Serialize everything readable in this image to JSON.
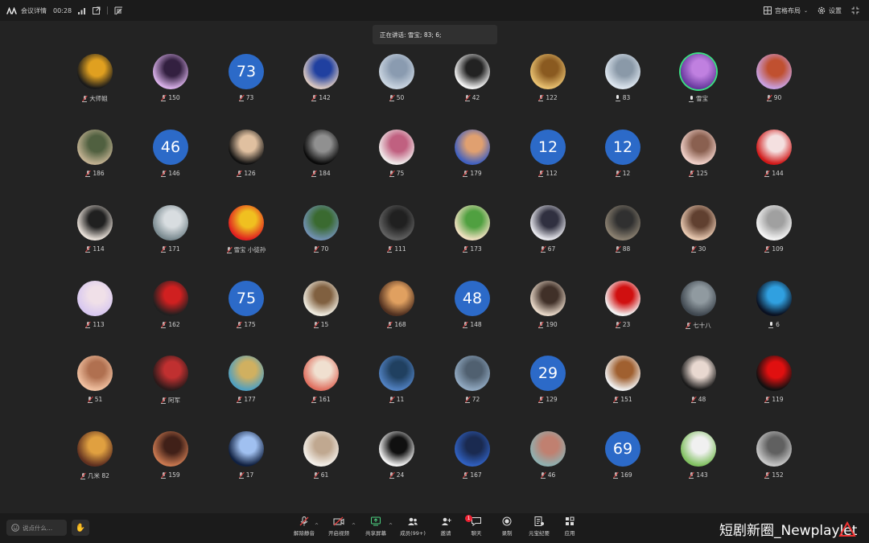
{
  "topbar": {
    "meeting_info": "会议详情",
    "duration": "00:28",
    "layout_label": "宫格布局",
    "settings_label": "设置"
  },
  "speaking": "正在讲话: 雪宝; 83; 6;",
  "participants": [
    {
      "name": "大师姐",
      "kind": "photo",
      "c1": "#1a1a1a",
      "c2": "#e0a020",
      "mic": "muted"
    },
    {
      "name": "150",
      "kind": "photo",
      "c1": "#d8b0e8",
      "c2": "#332040",
      "mic": "muted"
    },
    {
      "name": "73",
      "kind": "num",
      "initial": "73",
      "mic": "muted"
    },
    {
      "name": "142",
      "kind": "photo",
      "c1": "#d9c7c0",
      "c2": "#2040a0",
      "mic": "muted"
    },
    {
      "name": "50",
      "kind": "photo",
      "c1": "#c9d4e0",
      "c2": "#8a9bb0",
      "mic": "muted"
    },
    {
      "name": "42",
      "kind": "photo",
      "c1": "#f4f4f4",
      "c2": "#222222",
      "mic": "muted"
    },
    {
      "name": "122",
      "kind": "photo",
      "c1": "#e8c070",
      "c2": "#8a5a20",
      "mic": "muted"
    },
    {
      "name": "83",
      "kind": "photo",
      "c1": "#dde6ef",
      "c2": "#8a99a8",
      "mic": "live"
    },
    {
      "name": "雪宝",
      "kind": "photo",
      "c1": "#6a3aa0",
      "c2": "#c080e0",
      "mic": "live",
      "active": true
    },
    {
      "name": "90",
      "kind": "photo",
      "c1": "#c8a0e0",
      "c2": "#c05030",
      "mic": "muted"
    },
    {
      "name": "186",
      "kind": "photo",
      "c1": "#c0b090",
      "c2": "#506040",
      "mic": "muted"
    },
    {
      "name": "146",
      "kind": "num",
      "initial": "46",
      "mic": "muted"
    },
    {
      "name": "126",
      "kind": "photo",
      "c1": "#111111",
      "c2": "#e0c0a0",
      "mic": "muted"
    },
    {
      "name": "184",
      "kind": "photo",
      "c1": "#0a0a0a",
      "c2": "#909090",
      "mic": "muted"
    },
    {
      "name": "75",
      "kind": "photo",
      "c1": "#f0eaea",
      "c2": "#c06080",
      "mic": "muted"
    },
    {
      "name": "179",
      "kind": "photo",
      "c1": "#4060c0",
      "c2": "#e0a070",
      "mic": "muted"
    },
    {
      "name": "112",
      "kind": "num",
      "initial": "12",
      "mic": "muted"
    },
    {
      "name": "12",
      "kind": "num",
      "initial": "12",
      "mic": "muted"
    },
    {
      "name": "125",
      "kind": "photo",
      "c1": "#f0d0c8",
      "c2": "#8a6050",
      "mic": "muted"
    },
    {
      "name": "144",
      "kind": "photo",
      "c1": "#d01818",
      "c2": "#f4e0e0",
      "mic": "muted"
    },
    {
      "name": "114",
      "kind": "photo",
      "c1": "#e8e0d8",
      "c2": "#202020",
      "mic": "muted"
    },
    {
      "name": "171",
      "kind": "photo",
      "c1": "#7a8a90",
      "c2": "#d8dde0",
      "mic": "muted"
    },
    {
      "name": "雪宝 小徒孙",
      "kind": "photo",
      "c1": "#e02020",
      "c2": "#f0c020",
      "mic": "muted"
    },
    {
      "name": "70",
      "kind": "photo",
      "c1": "#7090b0",
      "c2": "#3a6a30",
      "mic": "muted"
    },
    {
      "name": "111",
      "kind": "photo",
      "c1": "#606060",
      "c2": "#202020",
      "mic": "muted"
    },
    {
      "name": "173",
      "kind": "photo",
      "c1": "#f0e0c0",
      "c2": "#50a040",
      "mic": "muted"
    },
    {
      "name": "67",
      "kind": "photo",
      "c1": "#e8e8ee",
      "c2": "#303040",
      "mic": "muted"
    },
    {
      "name": "88",
      "kind": "photo",
      "c1": "#8a8070",
      "c2": "#303030",
      "mic": "muted"
    },
    {
      "name": "30",
      "kind": "photo",
      "c1": "#e8c8b0",
      "c2": "#604030",
      "mic": "muted"
    },
    {
      "name": "109",
      "kind": "photo",
      "c1": "#f4f4f4",
      "c2": "#a0a0a0",
      "mic": "muted"
    },
    {
      "name": "113",
      "kind": "photo",
      "c1": "#d8c8f0",
      "c2": "#f0e0e8",
      "mic": "muted"
    },
    {
      "name": "162",
      "kind": "photo",
      "c1": "#202020",
      "c2": "#d02020",
      "mic": "muted"
    },
    {
      "name": "175",
      "kind": "num",
      "initial": "75",
      "mic": "muted"
    },
    {
      "name": "15",
      "kind": "photo",
      "c1": "#f0ece0",
      "c2": "#806040",
      "mic": "muted"
    },
    {
      "name": "168",
      "kind": "photo",
      "c1": "#503020",
      "c2": "#e0a060",
      "mic": "muted"
    },
    {
      "name": "148",
      "kind": "num",
      "initial": "48",
      "mic": "muted"
    },
    {
      "name": "190",
      "kind": "photo",
      "c1": "#e8d8c8",
      "c2": "#403028",
      "mic": "muted"
    },
    {
      "name": "23",
      "kind": "photo",
      "c1": "#f4f4f4",
      "c2": "#d01010",
      "mic": "muted"
    },
    {
      "name": "七十八",
      "kind": "photo",
      "c1": "#404850",
      "c2": "#909aa0",
      "mic": "muted"
    },
    {
      "name": "6",
      "kind": "photo",
      "c1": "#0a1020",
      "c2": "#30a0e0",
      "mic": "live"
    },
    {
      "name": "51",
      "kind": "photo",
      "c1": "#f0c0a0",
      "c2": "#b07050",
      "mic": "muted"
    },
    {
      "name": "阿军",
      "kind": "photo",
      "c1": "#2a1a1a",
      "c2": "#c03030",
      "mic": "muted"
    },
    {
      "name": "177",
      "kind": "photo",
      "c1": "#50a0c0",
      "c2": "#d0b060",
      "mic": "muted"
    },
    {
      "name": "161",
      "kind": "photo",
      "c1": "#e07060",
      "c2": "#f0e0d0",
      "mic": "muted"
    },
    {
      "name": "11",
      "kind": "photo",
      "c1": "#5080c0",
      "c2": "#204060",
      "mic": "muted"
    },
    {
      "name": "72",
      "kind": "photo",
      "c1": "#90a8c0",
      "c2": "#506070",
      "mic": "muted"
    },
    {
      "name": "129",
      "kind": "num",
      "initial": "29",
      "mic": "muted"
    },
    {
      "name": "151",
      "kind": "photo",
      "c1": "#f0f0f0",
      "c2": "#a06030",
      "mic": "muted"
    },
    {
      "name": "48",
      "kind": "photo",
      "c1": "#1a1a1a",
      "c2": "#e8d8d0",
      "mic": "muted"
    },
    {
      "name": "119",
      "kind": "photo",
      "c1": "#101010",
      "c2": "#e01010",
      "mic": "muted"
    },
    {
      "name": "几米 82",
      "kind": "photo",
      "c1": "#603020",
      "c2": "#e0a040",
      "mic": "muted"
    },
    {
      "name": "159",
      "kind": "photo",
      "c1": "#c87850",
      "c2": "#402018",
      "mic": "muted"
    },
    {
      "name": "17",
      "kind": "photo",
      "c1": "#102040",
      "c2": "#a0c0f0",
      "mic": "muted"
    },
    {
      "name": "61",
      "kind": "photo",
      "c1": "#f4f0ea",
      "c2": "#c0a890",
      "mic": "muted"
    },
    {
      "name": "24",
      "kind": "photo",
      "c1": "#f4f4f4",
      "c2": "#101010",
      "mic": "muted"
    },
    {
      "name": "167",
      "kind": "photo",
      "c1": "#3060c0",
      "c2": "#1a2a50",
      "mic": "muted"
    },
    {
      "name": "46",
      "kind": "photo",
      "c1": "#90b0b0",
      "c2": "#c08070",
      "mic": "muted"
    },
    {
      "name": "169",
      "kind": "num",
      "initial": "69",
      "mic": "muted"
    },
    {
      "name": "143",
      "kind": "photo",
      "c1": "#80c060",
      "c2": "#f0f0f0",
      "mic": "muted"
    },
    {
      "name": "152",
      "kind": "photo",
      "c1": "#c8c8c8",
      "c2": "#606060",
      "mic": "muted"
    }
  ],
  "bottombar": {
    "say_placeholder": "说点什么...",
    "controls": [
      "解除静音",
      "开启视频",
      "共享屏幕",
      "成员(99+)",
      "邀请",
      "聊天",
      "录制",
      "元宝纪要",
      "应用"
    ],
    "chat_badge": "1"
  },
  "watermark": "短剧新圈_Newplaylet",
  "colors": {
    "background": "#232323",
    "bar": "#1b1b1b",
    "number_avatar": "#2c6ac8",
    "active_ring": "#3ddc84",
    "muted_mic": "#e04040"
  }
}
